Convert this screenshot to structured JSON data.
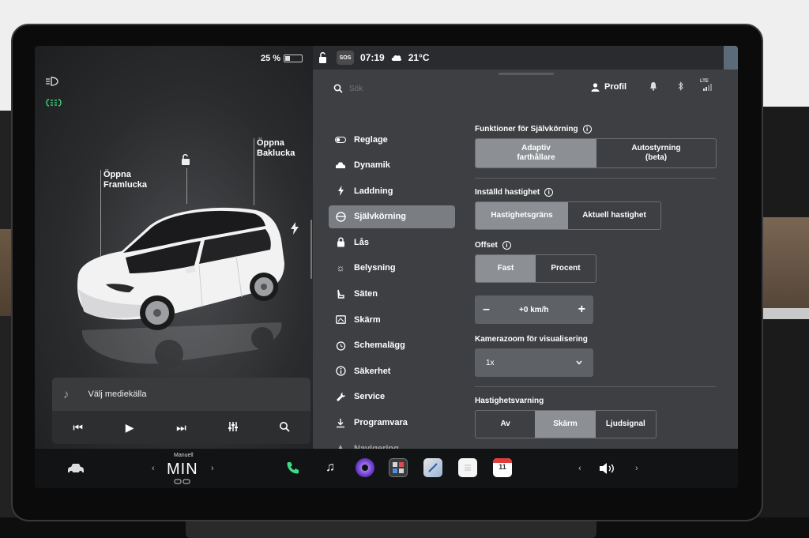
{
  "status": {
    "battery_percent": "25 %",
    "battery_level": 0.25,
    "sos": "SOS",
    "time": "07:19",
    "temperature": "21°C"
  },
  "car": {
    "frunk_label_line1": "Öppna",
    "frunk_label_line2": "Framlucka",
    "trunk_label_line1": "Öppna",
    "trunk_label_line2": "Baklucka"
  },
  "media": {
    "source": "Välj mediekälla"
  },
  "header": {
    "search_placeholder": "Sök",
    "profile": "Profil",
    "lte": "LTE"
  },
  "menu": {
    "items": [
      {
        "label": "Reglage",
        "icon": "toggle-icon"
      },
      {
        "label": "Dynamik",
        "icon": "car-icon"
      },
      {
        "label": "Laddning",
        "icon": "bolt-icon"
      },
      {
        "label": "Självkörning",
        "icon": "steering-wheel-icon"
      },
      {
        "label": "Lås",
        "icon": "lock-icon"
      },
      {
        "label": "Belysning",
        "icon": "sun-icon"
      },
      {
        "label": "Säten",
        "icon": "seat-icon"
      },
      {
        "label": "Skärm",
        "icon": "display-icon"
      },
      {
        "label": "Schemalägg",
        "icon": "alarm-icon"
      },
      {
        "label": "Säkerhet",
        "icon": "info-icon"
      },
      {
        "label": "Service",
        "icon": "wrench-icon"
      },
      {
        "label": "Programvara",
        "icon": "download-icon"
      },
      {
        "label": "Navigering",
        "icon": "navigation-icon"
      }
    ],
    "active_index": 3
  },
  "autopilot": {
    "features_title": "Funktioner för Självkörning",
    "features_opt1_line1": "Adaptiv",
    "features_opt1_line2": "farthållare",
    "features_opt2_line1": "Autostyrning",
    "features_opt2_line2": "(beta)",
    "speed_title": "Inställd hastighet",
    "speed_opt1": "Hastighetsgräns",
    "speed_opt2": "Aktuell hastighet",
    "offset_title": "Offset",
    "offset_opt1": "Fast",
    "offset_opt2": "Procent",
    "offset_value": "+0 km/h",
    "minus": "–",
    "plus": "+",
    "zoom_title": "Kamerazoom för visualisering",
    "zoom_value": "1x",
    "warning_title": "Hastighetsvarning",
    "warning_opt1": "Av",
    "warning_opt2": "Skärm",
    "warning_opt3": "Ljudsignal"
  },
  "dock": {
    "gear_label": "Manuell",
    "gear_value": "MIN",
    "calendar_day": "11"
  },
  "colors": {
    "accent_green": "#3ddc84",
    "panel_bg": "#3d3f43",
    "selected_segment": "#8c8f94"
  }
}
